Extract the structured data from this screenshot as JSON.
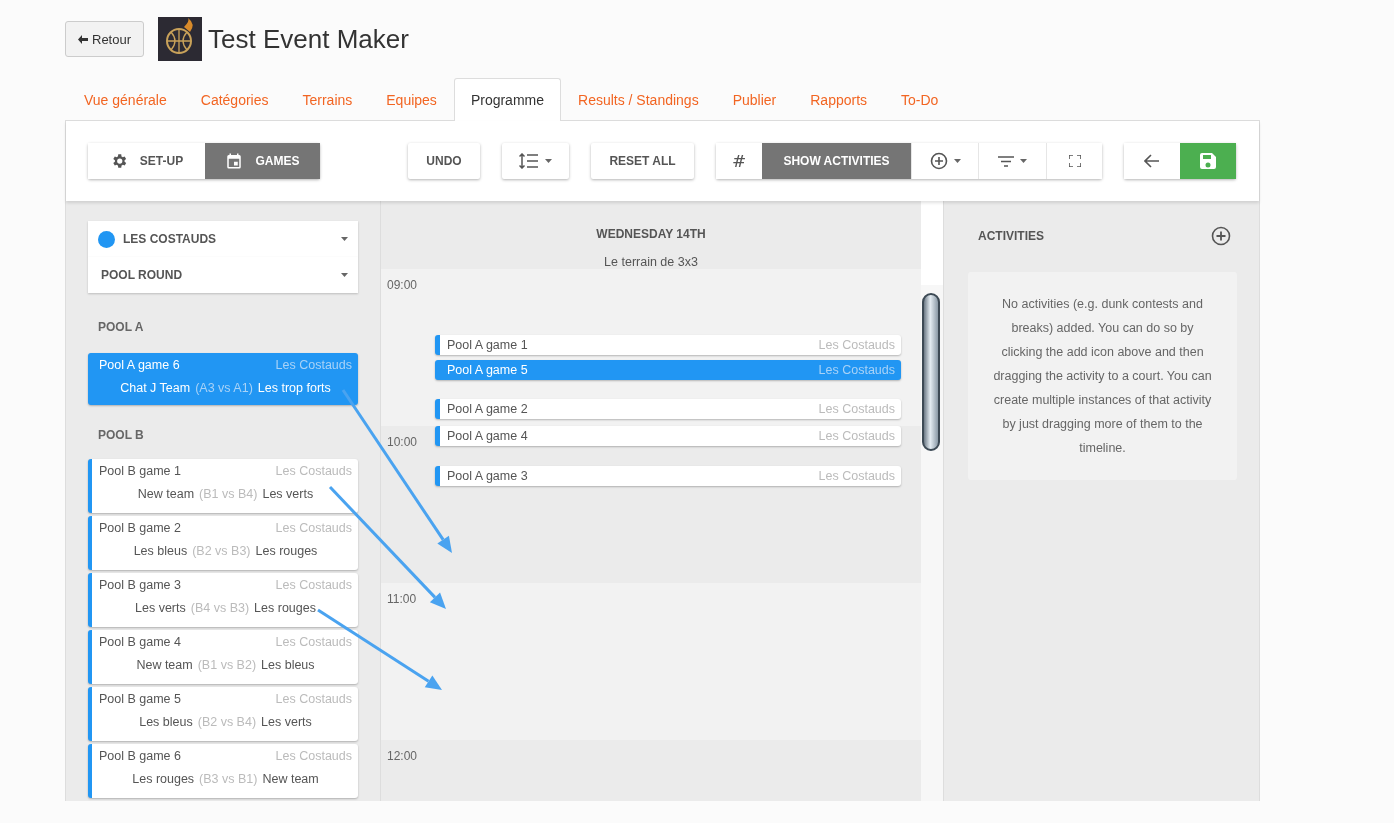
{
  "header": {
    "back_button": "Retour",
    "event_title": "Test Event Maker"
  },
  "tabs": [
    {
      "label": "Vue générale",
      "selected": false
    },
    {
      "label": "Catégories",
      "selected": false
    },
    {
      "label": "Terrains",
      "selected": false
    },
    {
      "label": "Equipes",
      "selected": false
    },
    {
      "label": "Programme",
      "selected": true
    },
    {
      "label": "Results / Standings",
      "selected": false
    },
    {
      "label": "Publier",
      "selected": false
    },
    {
      "label": "Rapports",
      "selected": false
    },
    {
      "label": "To-Do",
      "selected": false
    }
  ],
  "toolbar": {
    "view_toggle": [
      {
        "label": "SET-UP",
        "selected": false
      },
      {
        "label": "GAMES",
        "selected": true
      }
    ],
    "undo": "UNDO",
    "reset": "RESET ALL",
    "number_toggle": "#",
    "show_activities": {
      "label": "SHOW ACTIVITIES",
      "on": true
    }
  },
  "sidebar": {
    "category": "LES COSTAUDS",
    "round": "POOL ROUND",
    "pools": [
      {
        "title": "POOL A",
        "games": [
          {
            "name": "Pool A game 6",
            "category": "Les Costauds",
            "home": "Chat J Team",
            "code": "(A3 vs A1)",
            "away": "Les trop forts",
            "selected": true
          }
        ]
      },
      {
        "title": "POOL B",
        "games": [
          {
            "name": "Pool B game 1",
            "category": "Les Costauds",
            "home": "New team",
            "code": "(B1 vs B4)",
            "away": "Les verts",
            "selected": false
          },
          {
            "name": "Pool B game 2",
            "category": "Les Costauds",
            "home": "Les bleus",
            "code": "(B2 vs B3)",
            "away": "Les rouges",
            "selected": false
          },
          {
            "name": "Pool B game 3",
            "category": "Les Costauds",
            "home": "Les verts",
            "code": "(B4 vs B3)",
            "away": "Les rouges",
            "selected": false
          },
          {
            "name": "Pool B game 4",
            "category": "Les Costauds",
            "home": "New team",
            "code": "(B1 vs B2)",
            "away": "Les bleus",
            "selected": false
          },
          {
            "name": "Pool B game 5",
            "category": "Les Costauds",
            "home": "Les bleus",
            "code": "(B2 vs B4)",
            "away": "Les verts",
            "selected": false
          },
          {
            "name": "Pool B game 6",
            "category": "Les Costauds",
            "home": "Les rouges",
            "code": "(B3 vs B1)",
            "away": "New team",
            "selected": false
          }
        ]
      }
    ]
  },
  "schedule": {
    "day": "WEDNESDAY 14TH",
    "court": "Le terrain de 3x3",
    "hours": [
      "09:00",
      "10:00",
      "11:00",
      "12:00"
    ],
    "games": [
      {
        "name": "Pool A game 1",
        "category": "Les Costauds",
        "selected": false
      },
      {
        "name": "Pool A game 5",
        "category": "Les Costauds",
        "selected": true
      },
      {
        "name": "Pool A game 2",
        "category": "Les Costauds",
        "selected": false
      },
      {
        "name": "Pool A game 4",
        "category": "Les Costauds",
        "selected": false
      },
      {
        "name": "Pool A game 3",
        "category": "Les Costauds",
        "selected": false
      }
    ]
  },
  "activities": {
    "title": "ACTIVITIES",
    "empty_text": "No activities (e.g. dunk contests and breaks) added. You can do so by clicking the add icon above and then dragging the activity to a court. You can create multiple instances of that activity by just dragging more of them to the timeline."
  }
}
